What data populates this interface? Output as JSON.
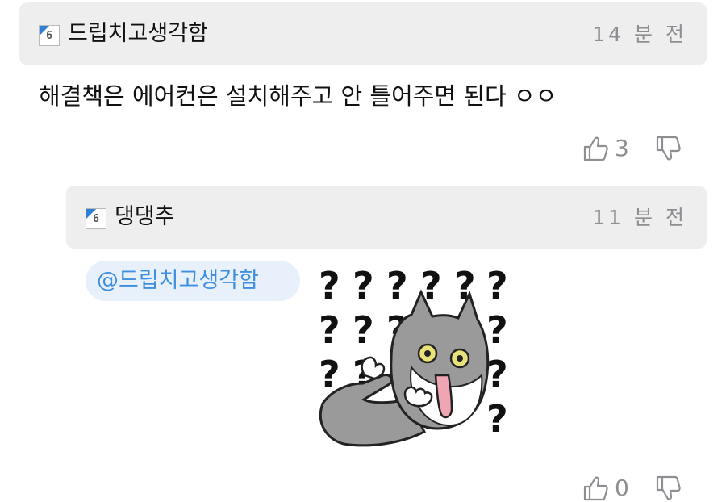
{
  "comments": [
    {
      "author": "드립치고생각함",
      "level": "6",
      "time": "14 분 전",
      "body": "해결책은 에어컨은 설치해주고 안 틀어주면 된다 ㅇㅇ",
      "likes": "3"
    },
    {
      "author": "댕댕추",
      "level": "6",
      "time": "11 분 전",
      "mention": "@드립치고생각함",
      "sticker": {
        "description": "gray cat pointing sticker surrounded by question marks",
        "glyph": "?"
      },
      "likes": "0"
    }
  ],
  "icons": {
    "level_badge": "level-badge-icon",
    "like": "thumbs-up-icon",
    "dislike": "thumbs-down-icon"
  },
  "colors": {
    "header_bg": "#eeeeef",
    "mention_bg": "#e8f1fb",
    "mention_text": "#3f8fe0",
    "badge_accent": "#2f7fd8",
    "muted": "#8e8e93"
  }
}
